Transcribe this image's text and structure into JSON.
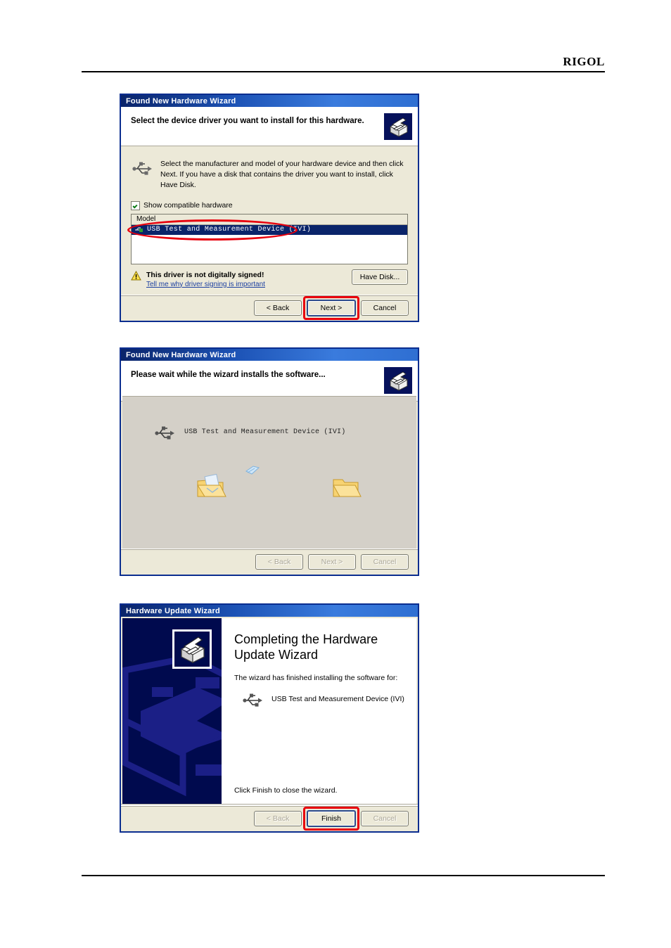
{
  "page": {
    "brand": "RIGOL"
  },
  "dialog1": {
    "title": "Found New Hardware Wizard",
    "heading": "Select the device driver you want to install for this hardware.",
    "instructions": "Select the manufacturer and model of your hardware device and then click Next. If you have a disk that contains the driver you want to install, click Have Disk.",
    "checkbox_label": "Show compatible hardware",
    "list_header": "Model",
    "list_rows": [
      "USB Test and Measurement Device (IVI)"
    ],
    "have_disk_label": "Have Disk...",
    "warning_title": "This driver is not digitally signed!",
    "warning_link": "Tell me why driver signing is important",
    "buttons": {
      "back": "< Back",
      "next": "Next >",
      "cancel": "Cancel"
    },
    "icons": {
      "wizard": "hardware-wizard-icon",
      "usb": "usb-icon",
      "warning": "warning-triangle-icon",
      "checkbox": "checkbox-checked-icon"
    },
    "highlight_color": "#e8000d"
  },
  "dialog2": {
    "title": "Found New Hardware Wizard",
    "heading": "Please wait while the wizard installs the software...",
    "device_label": "USB Test and Measurement Device (IVI)",
    "buttons": {
      "back": "< Back",
      "next": "Next >",
      "cancel": "Cancel"
    },
    "icons": {
      "wizard": "hardware-wizard-icon",
      "usb": "usb-icon",
      "source_folder": "open-folder-with-document-icon",
      "flying_page": "flying-document-icon",
      "target_folder": "open-folder-icon"
    }
  },
  "dialog3": {
    "title": "Hardware Update Wizard",
    "heading": "Completing the Hardware Update Wizard",
    "subtext": "The wizard has finished installing the software for:",
    "device_label": "USB Test and Measurement Device (IVI)",
    "footer_text": "Click Finish to close the wizard.",
    "buttons": {
      "back": "< Back",
      "finish": "Finish",
      "cancel": "Cancel"
    },
    "icons": {
      "wizard": "hardware-wizard-icon",
      "usb": "usb-icon",
      "watermark": "hardware-wizard-watermark-icon"
    },
    "highlight_color": "#e8000d"
  }
}
